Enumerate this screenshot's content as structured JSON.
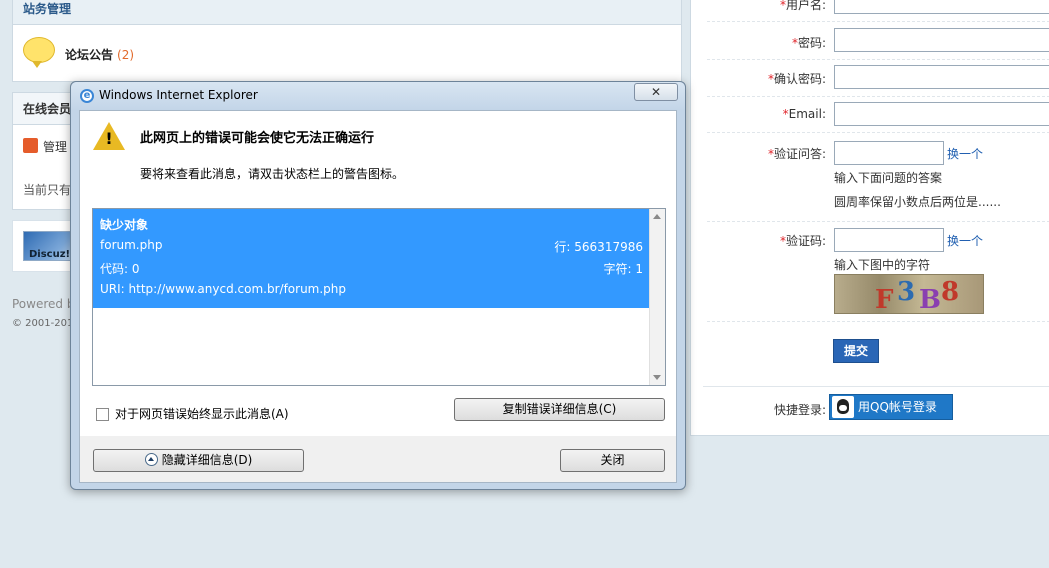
{
  "window": {
    "title": "Windows Internet Explorer",
    "close_glyph": "✕"
  },
  "background": {
    "forum": {
      "section_title": "站务管理",
      "forum_name": "论坛公告",
      "forum_count": "(2)",
      "online_title": "在线会员",
      "admin_label": "管理",
      "online_note": "当前只有",
      "logo_text": "Discuz!",
      "powered_by": "Powered b",
      "copyright": "© 2001-201"
    },
    "register": {
      "username_label": "用户名:",
      "password_label": "密码:",
      "confirm_label": "确认密码:",
      "email_label": "Email:",
      "question_label": "验证问答:",
      "question_change": "换一个",
      "question_hint": "输入下面问题的答案",
      "question_text": "圆周率保留小数点后两位是......",
      "captcha_label": "验证码:",
      "captcha_change": "换一个",
      "captcha_hint": "输入下图中的字符",
      "captcha_chars": "F3B8",
      "submit_label": "提交",
      "quick_login_label": "快捷登录:",
      "qq_login_label": "用QQ帐号登录"
    }
  },
  "dialog": {
    "heading": "此网页上的错误可能会使它无法正确运行",
    "subtext": "要将来查看此消息，请双击状态栏上的警告图标。",
    "error": {
      "title": "缺少对象",
      "file": "forum.php",
      "line": "行: 566317986",
      "code": "代码: 0",
      "char": "字符: 1",
      "uri": "URI: http://www.anycd.com.br/forum.php"
    },
    "checkbox_label": "对于网页错误始终显示此消息(A)",
    "copy_button": "复制错误详细信息(C)",
    "hide_button": "隐藏详细信息(D)",
    "close_button": "关闭"
  }
}
